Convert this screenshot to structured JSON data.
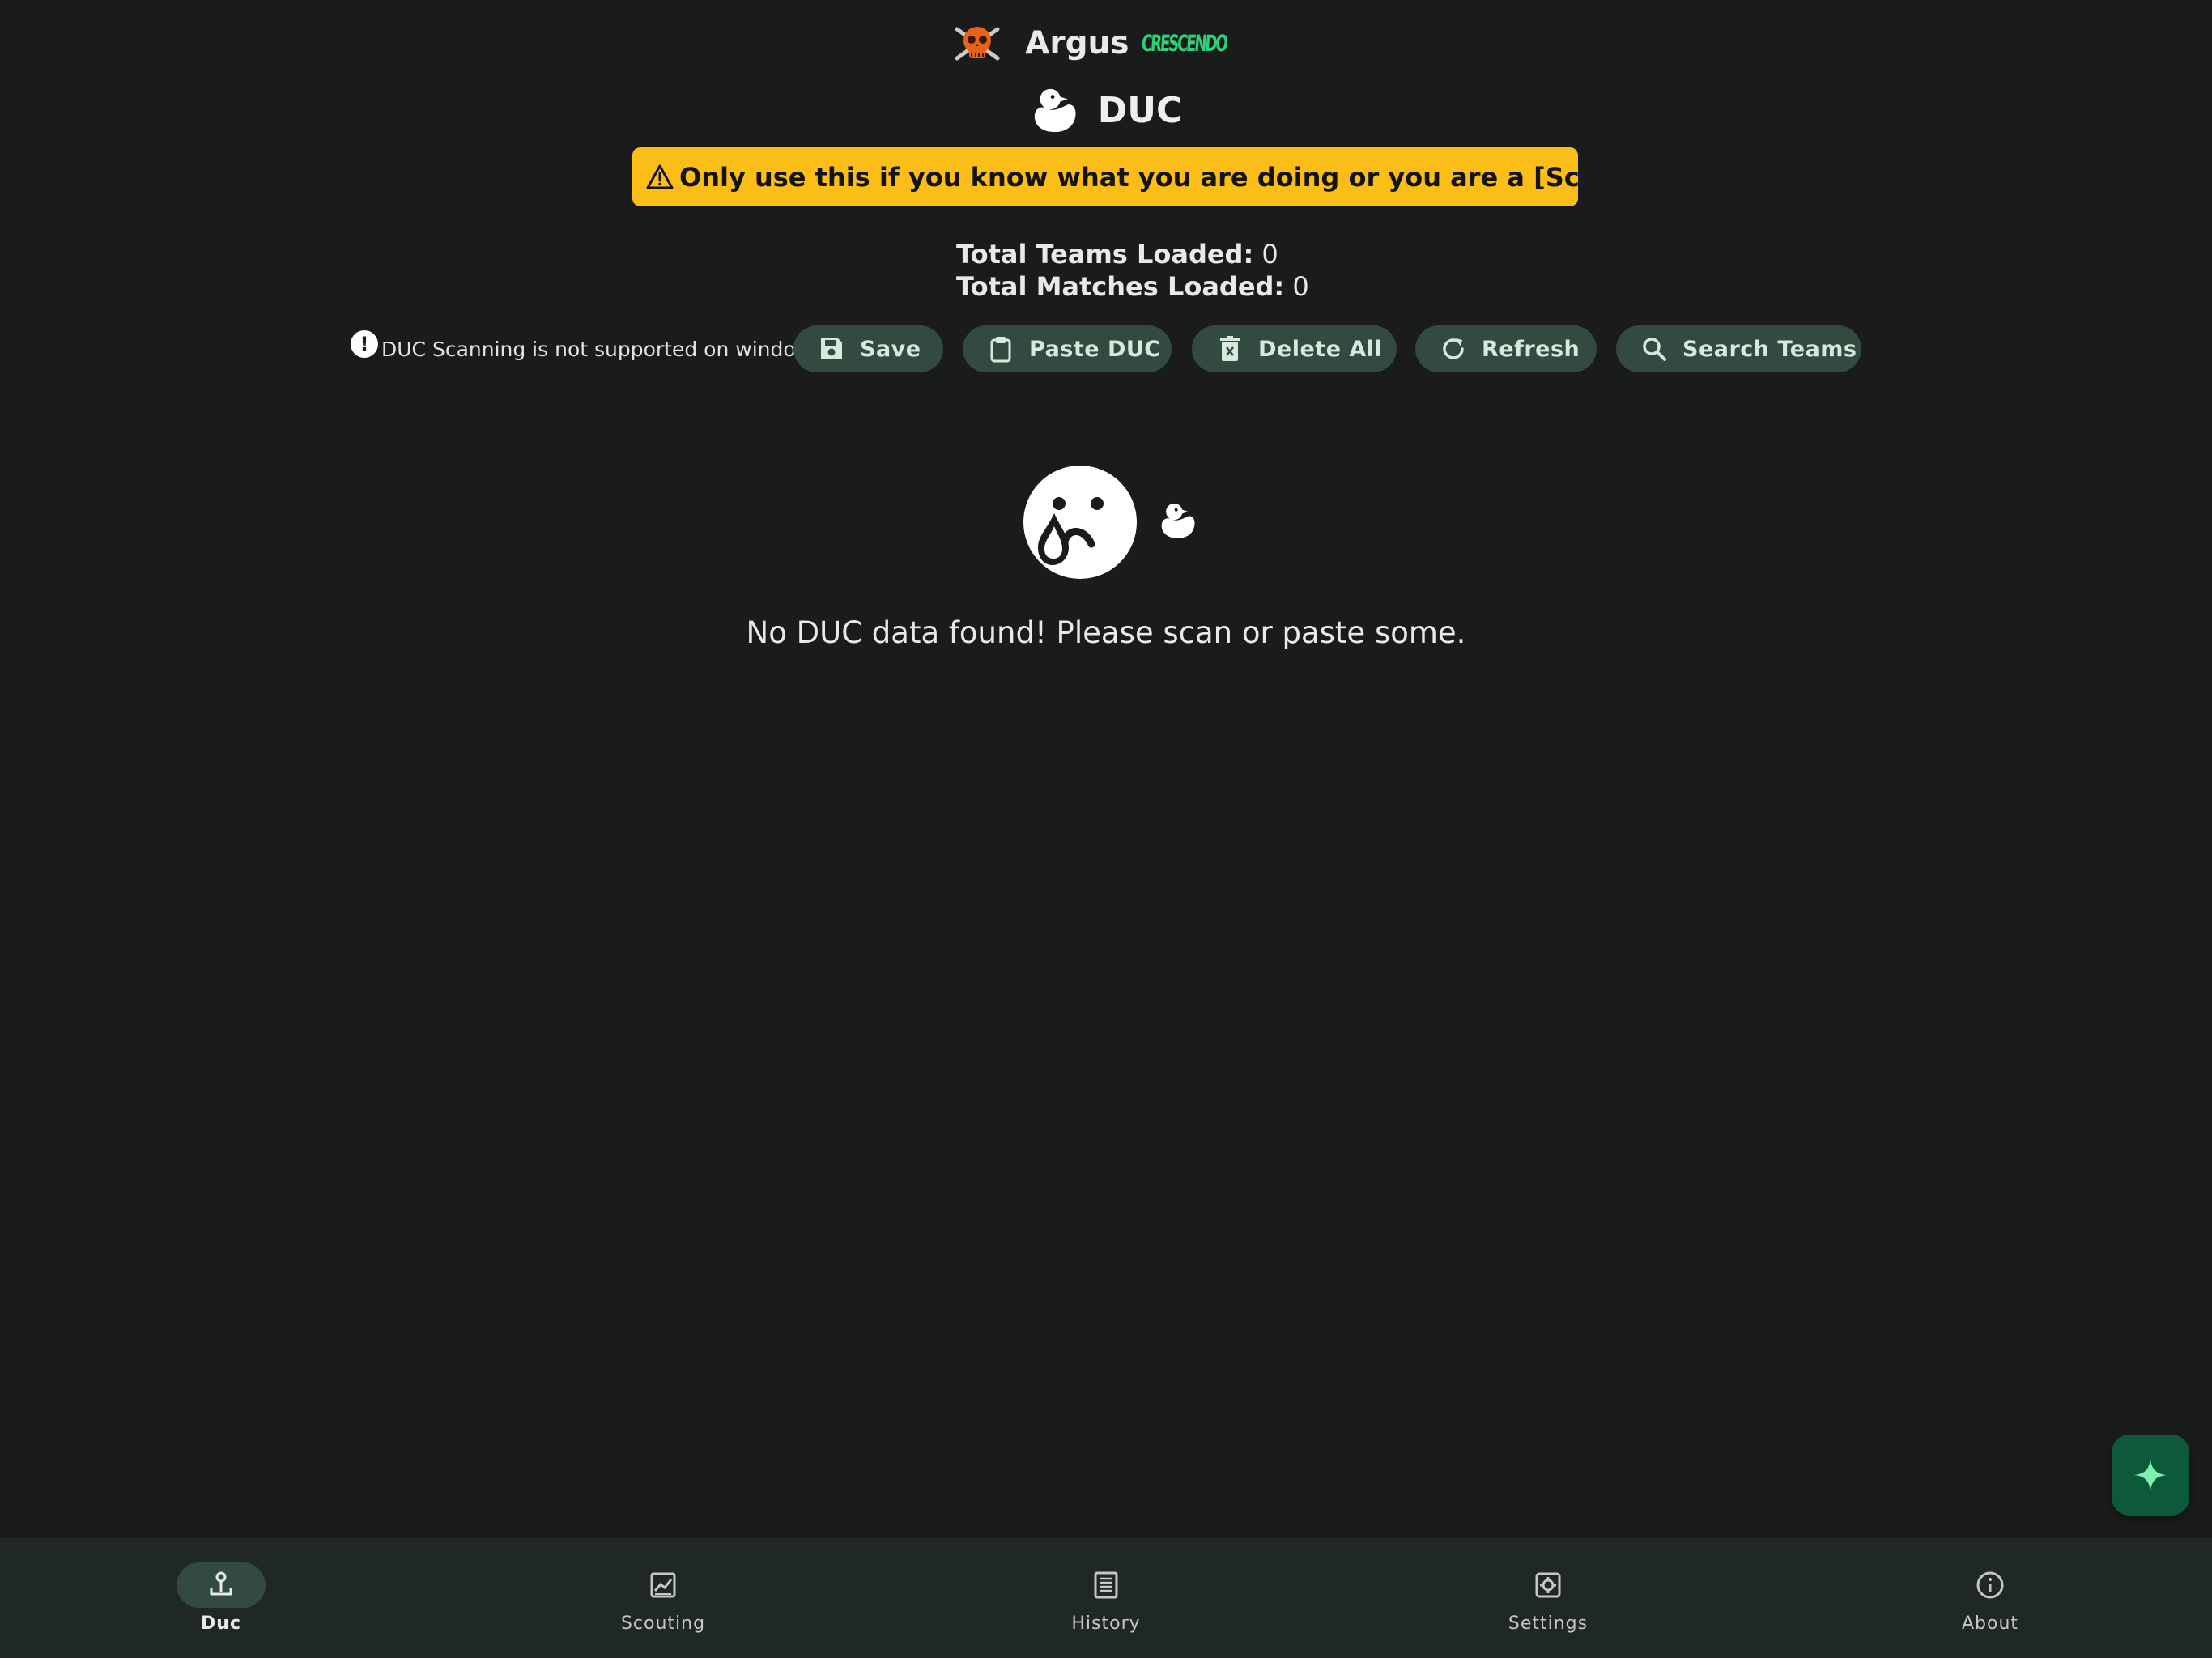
{
  "app": {
    "title": "Argus",
    "badge": "CRESCENDO"
  },
  "page": {
    "title": "DUC",
    "warning": "Only use this if you know what you are doing or you are a [Scouting Leader]"
  },
  "stats": {
    "teams_label": "Total Teams Loaded:",
    "teams_value": "0",
    "matches_label": "Total Matches Loaded:",
    "matches_value": "0"
  },
  "toolbar": {
    "note": "DUC Scanning is not supported on windows",
    "save": "Save",
    "paste": "Paste DUC",
    "delete_all": "Delete All",
    "refresh": "Refresh",
    "search_teams": "Search Teams"
  },
  "empty_state": {
    "message": "No DUC data found! Please scan or paste some."
  },
  "nav": {
    "items": [
      {
        "label": "Duc",
        "icon": "duc-icon",
        "active": true
      },
      {
        "label": "Scouting",
        "icon": "chart-icon",
        "active": false
      },
      {
        "label": "History",
        "icon": "history-icon",
        "active": false
      },
      {
        "label": "Settings",
        "icon": "settings-icon",
        "active": false
      },
      {
        "label": "About",
        "icon": "info-icon",
        "active": false
      }
    ]
  },
  "colors": {
    "background": "#191c1b",
    "warning": "#fbbd17",
    "button": "#334a40",
    "navbar": "#202826",
    "fab": "#0d5a3a",
    "badge": "#2ed17a",
    "fab_icon": "#7ef0b0"
  }
}
